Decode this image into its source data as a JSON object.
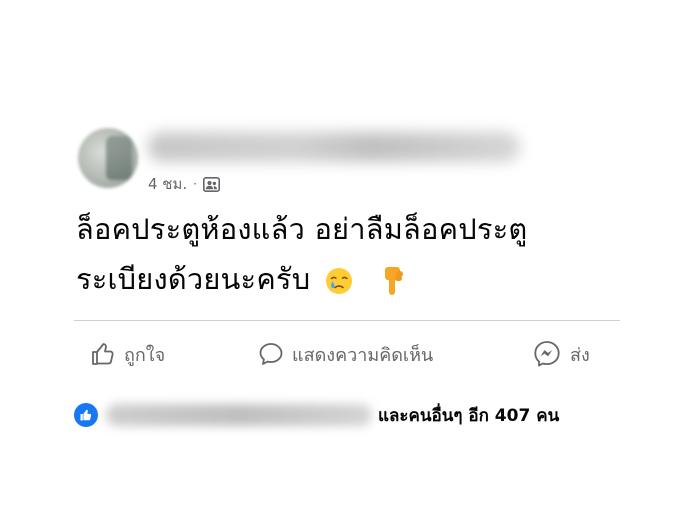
{
  "post": {
    "author_name": "",
    "time": "4 ชม.",
    "separator": "·",
    "audience_icon": "friends-icon",
    "text_line1": "ล็อคประตูห้องแล้ว อย่าลืมล็อคประตู",
    "text_line2": "ระเบียงด้วยนะครับ",
    "emojis": [
      "crying-face-emoji",
      "pointing-down-emoji"
    ]
  },
  "actions": {
    "like_label": "ถูกใจ",
    "comment_label": "แสดงความคิดเห็น",
    "share_label": "ส่ง"
  },
  "reactions": {
    "icon": "like-icon",
    "summary": "และคนอื่นๆ อีก 407 คน"
  },
  "colors": {
    "accent": "#1877f2",
    "secondary_text": "#65676b",
    "divider": "#ced0d4"
  }
}
